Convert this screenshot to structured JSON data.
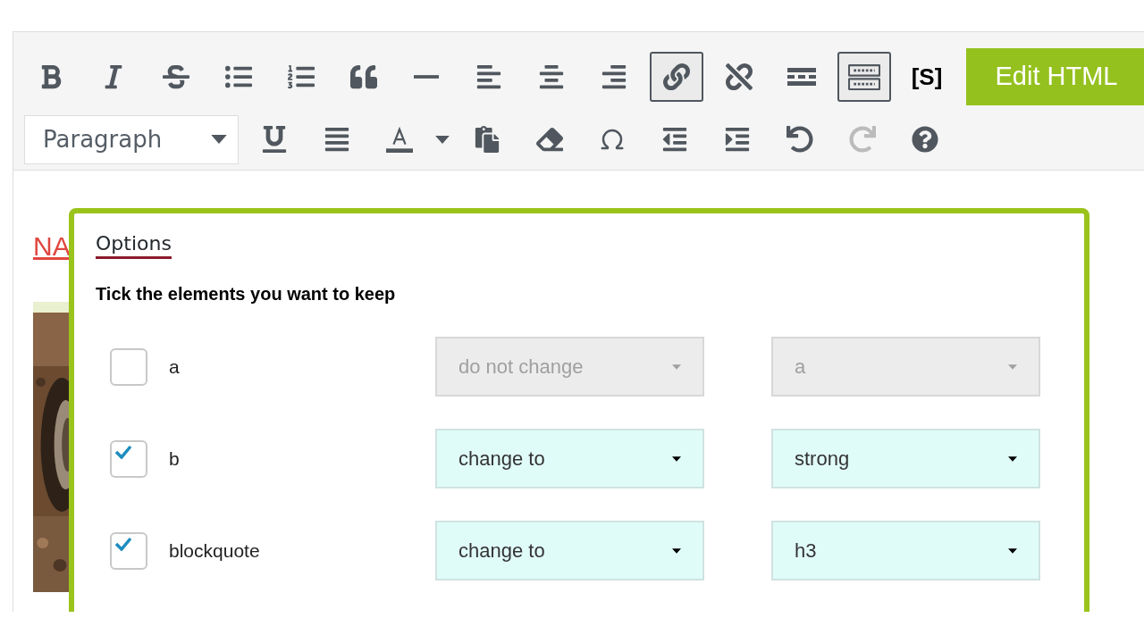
{
  "toolbar": {
    "rows": [
      {
        "items": [
          {
            "kind": "icon",
            "pressed": false,
            "disabled": false
          },
          {
            "kind": "icon",
            "pressed": false,
            "disabled": false
          },
          {
            "kind": "icon",
            "pressed": false,
            "disabled": false
          },
          {
            "kind": "icon",
            "pressed": false,
            "disabled": false
          },
          {
            "kind": "icon",
            "pressed": false,
            "disabled": false
          },
          {
            "kind": "icon",
            "pressed": false,
            "disabled": false
          },
          {
            "kind": "icon",
            "pressed": false,
            "disabled": false
          },
          {
            "kind": "icon",
            "pressed": false,
            "disabled": false
          },
          {
            "kind": "icon",
            "pressed": false,
            "disabled": false
          },
          {
            "kind": "icon",
            "pressed": false,
            "disabled": false
          },
          {
            "kind": "icon",
            "pressed": true,
            "disabled": false
          },
          {
            "kind": "icon",
            "pressed": false,
            "disabled": false
          },
          {
            "kind": "icon",
            "pressed": false,
            "disabled": false
          },
          {
            "kind": "icon",
            "pressed": true,
            "disabled": false
          },
          {
            "kind": "text",
            "label": "[S]"
          },
          {
            "kind": "action",
            "label": "Edit HTML"
          }
        ]
      },
      {
        "items": [
          {
            "kind": "select",
            "value": "Paragraph"
          },
          {
            "kind": "icon",
            "pressed": false,
            "disabled": false
          },
          {
            "kind": "icon",
            "pressed": false,
            "disabled": false
          },
          {
            "kind": "icon",
            "pressed": false,
            "disabled": false
          },
          {
            "kind": "icon",
            "pressed": false,
            "disabled": false
          },
          {
            "kind": "icon",
            "pressed": false,
            "disabled": false
          },
          {
            "kind": "icon",
            "pressed": false,
            "disabled": false
          },
          {
            "kind": "icon",
            "pressed": false,
            "disabled": false
          },
          {
            "kind": "icon",
            "pressed": false,
            "disabled": false
          },
          {
            "kind": "icon",
            "pressed": false,
            "disabled": false
          },
          {
            "kind": "icon",
            "pressed": false,
            "disabled": false
          },
          {
            "kind": "icon",
            "pressed": false,
            "disabled": true
          },
          {
            "kind": "icon",
            "pressed": false,
            "disabled": false
          }
        ]
      }
    ]
  },
  "content": {
    "link": "NA"
  },
  "dialog": {
    "tab": "Options",
    "heading": "Tick the elements you want to keep",
    "rows": [
      {
        "tag": "a",
        "checked": false,
        "action": "do not change",
        "target": "a"
      },
      {
        "tag": "b",
        "checked": true,
        "action": "change to",
        "target": "strong"
      },
      {
        "tag": "blockquote",
        "checked": true,
        "action": "change to",
        "target": "h3"
      }
    ]
  }
}
